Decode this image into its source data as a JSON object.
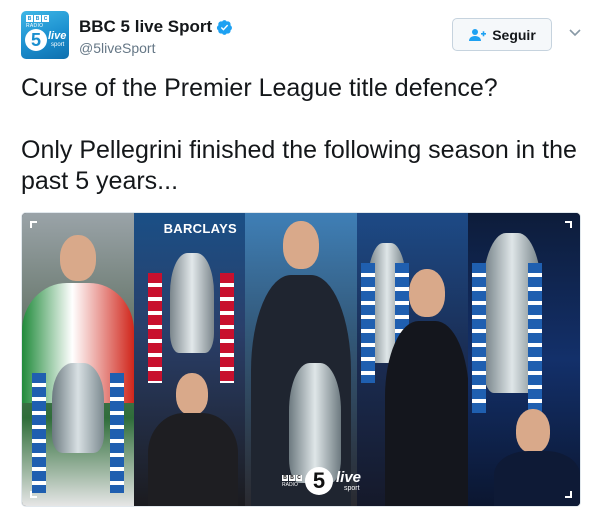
{
  "account": {
    "display_name": "BBC 5 live Sport",
    "handle": "@5liveSport",
    "verified": true,
    "avatar_icon": "bbc-5-live-sport-logo",
    "avatar_text": {
      "bbc": [
        "B",
        "B",
        "C"
      ],
      "radio": "RADIO",
      "number": "5",
      "live": "live",
      "sport": "sport"
    }
  },
  "actions": {
    "follow_label": "Seguir",
    "follow_icon": "add-user-icon",
    "more_icon": "chevron-down-icon"
  },
  "tweet": {
    "line1": "Curse of the Premier League title defence?",
    "line2": "Only Pellegrini finished the following season in the past 5 years..."
  },
  "media": {
    "panels": [
      "manager-photo-1",
      "manager-photo-2",
      "manager-photo-3",
      "manager-photo-4",
      "manager-photo-5"
    ],
    "sponsor_text": "BARCLAYS",
    "watermark": {
      "bbc": [
        "B",
        "B",
        "C"
      ],
      "radio": "RADIO",
      "number": "5",
      "live": "live",
      "sport": "sport"
    }
  },
  "colors": {
    "brand_blue": "#1da1f2",
    "avatar_blue": "#1b8fcf",
    "text": "#14171a",
    "muted": "#657786",
    "button_bg": "#f5f8fa",
    "button_border": "#c6d3de"
  }
}
